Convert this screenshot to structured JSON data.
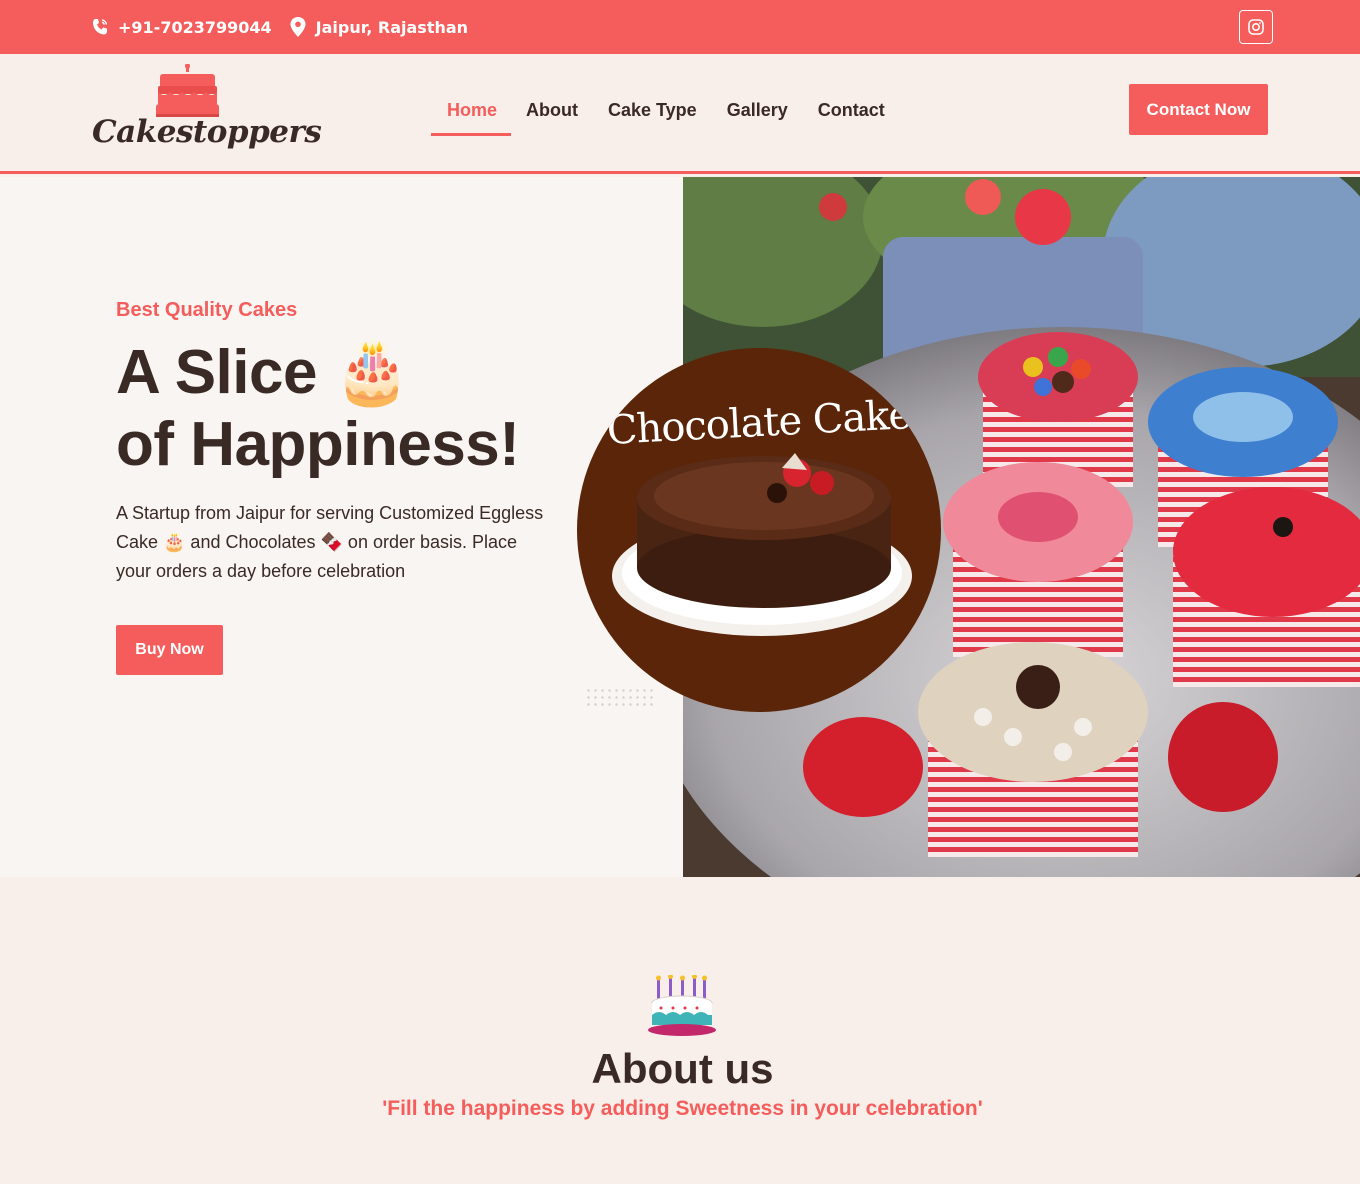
{
  "topbar": {
    "phone": "+91-7023799044",
    "location": "Jaipur, Rajasthan",
    "icons": [
      "phone-icon",
      "location-pin-icon",
      "instagram-icon"
    ]
  },
  "header": {
    "logo_text": "Cakestoppers",
    "nav": [
      {
        "label": "Home",
        "active": true
      },
      {
        "label": "About",
        "active": false
      },
      {
        "label": "Cake Type",
        "active": false
      },
      {
        "label": "Gallery",
        "active": false
      },
      {
        "label": "Contact",
        "active": false
      }
    ],
    "cta_label": "Contact Now"
  },
  "hero": {
    "subtitle": "Best Quality Cakes",
    "title_line1": "A Slice 🎂",
    "title_line2": "of Happiness!",
    "description": "A Startup from Jaipur for serving Customized Eggless Cake 🎂 and Chocolates 🍫 on order basis. Place your orders a day before celebration",
    "buy_label": "Buy Now",
    "promo_title": "Chocolate Cake"
  },
  "about": {
    "heading": "About us",
    "tagline": "'Fill the happiness by adding Sweetness in your celebration'"
  },
  "colors": {
    "accent": "#f45d5b",
    "dark_text": "#3a2a26",
    "background": "#f9efea",
    "promo_bg": "#5a2508"
  }
}
